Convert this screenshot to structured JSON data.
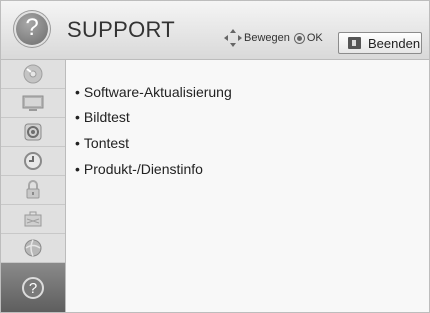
{
  "header": {
    "title": "SUPPORT",
    "help_glyph": "?",
    "nav_hint": "Bewegen",
    "ok_hint": "OK",
    "exit_label": "Beenden"
  },
  "sidebar": {
    "items": [
      {
        "icon": "picture-wizard-icon",
        "selected": false
      },
      {
        "icon": "tv-picture-icon",
        "selected": false
      },
      {
        "icon": "audio-speaker-icon",
        "selected": false
      },
      {
        "icon": "clock-icon",
        "selected": false
      },
      {
        "icon": "lock-icon",
        "selected": false
      },
      {
        "icon": "option-toolbox-icon",
        "selected": false
      },
      {
        "icon": "network-globe-icon",
        "selected": false
      },
      {
        "icon": "support-help-icon",
        "selected": true
      }
    ]
  },
  "menu": {
    "bullet": "•",
    "items": [
      {
        "label": "Software-Aktualisierung"
      },
      {
        "label": "Bildtest"
      },
      {
        "label": "Tontest"
      },
      {
        "label": "Produkt-/Dienstinfo"
      }
    ]
  },
  "colors": {
    "header_bg": "#e4e4e4",
    "sidebar_bg": "#e0e0e0",
    "selected_bg": "#6e6e6e",
    "text": "#222222"
  }
}
